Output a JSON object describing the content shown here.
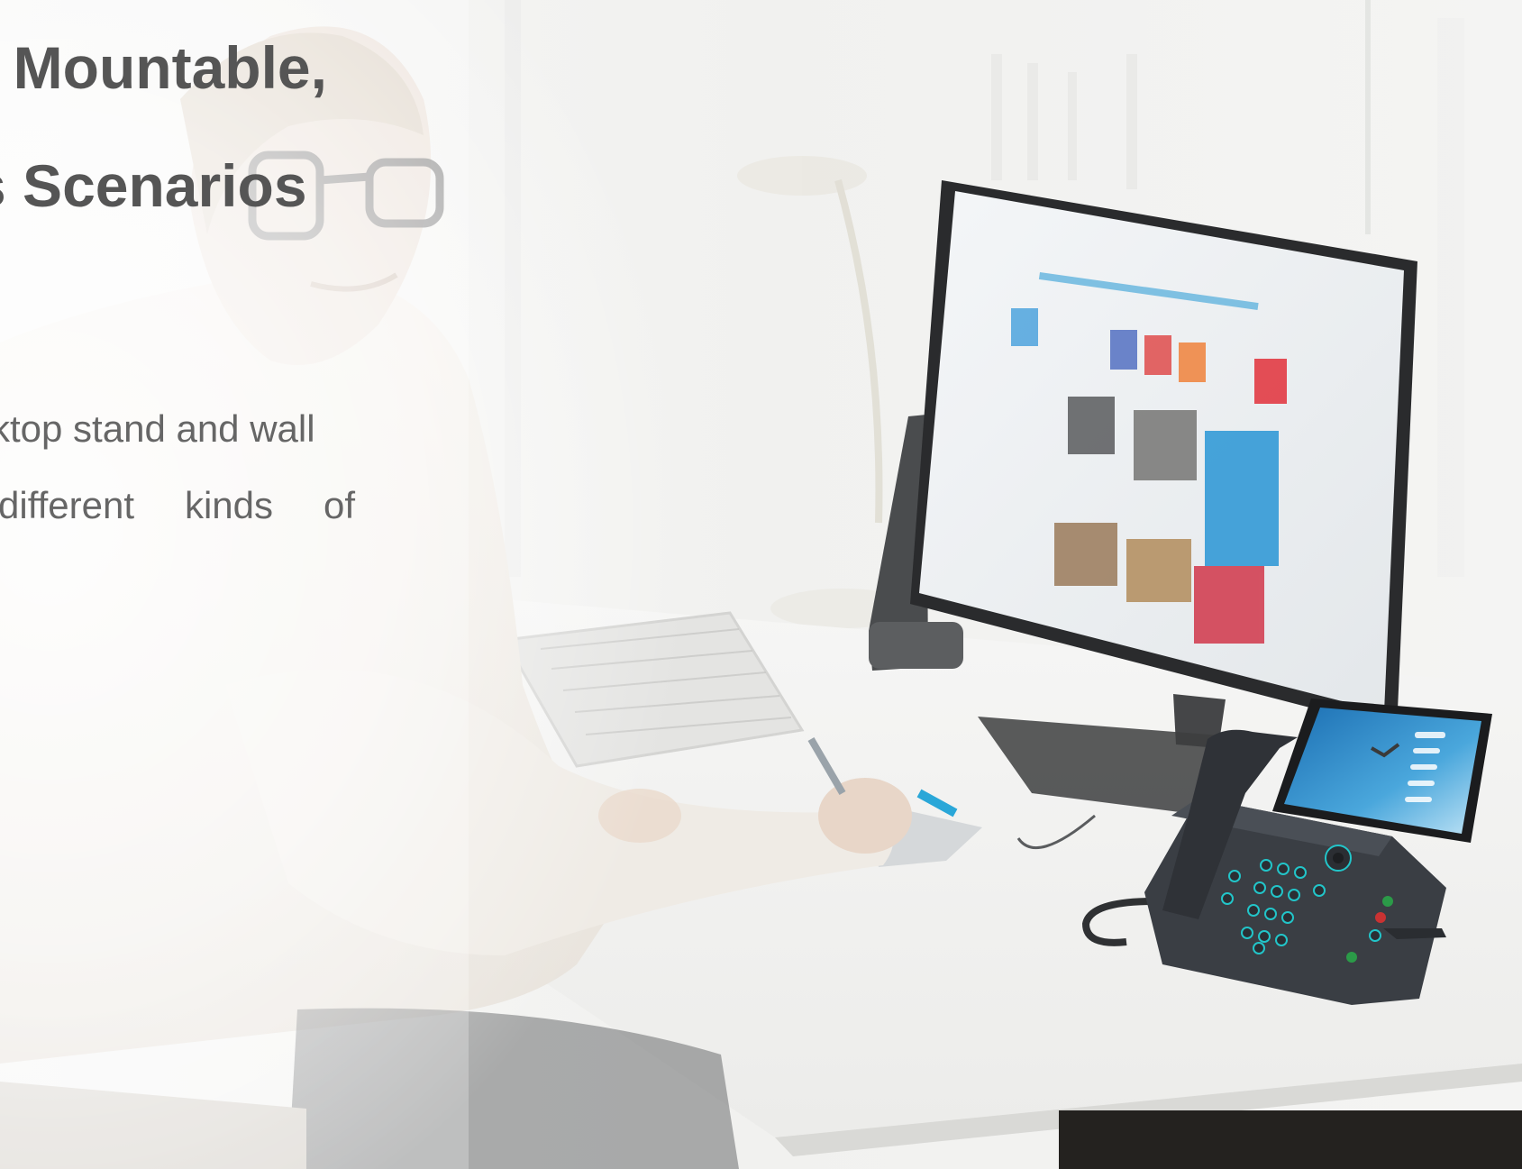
{
  "headline": {
    "line1": "l Mountable,",
    "line2": "s Scenarios"
  },
  "body": {
    "line1": "ktop stand and wall",
    "line2": "different kinds of"
  },
  "icons": {
    "monitor": "desktop-monitor-icon",
    "phone": "ip-desk-phone-icon",
    "keyboard": "keyboard-icon",
    "person": "person-photo-icon"
  },
  "colors": {
    "text_heading": "#555555",
    "text_body": "#666666",
    "phone_screen": "#2e8ec6",
    "phone_body": "#3a3e44",
    "key_glow": "#22c5c9"
  }
}
